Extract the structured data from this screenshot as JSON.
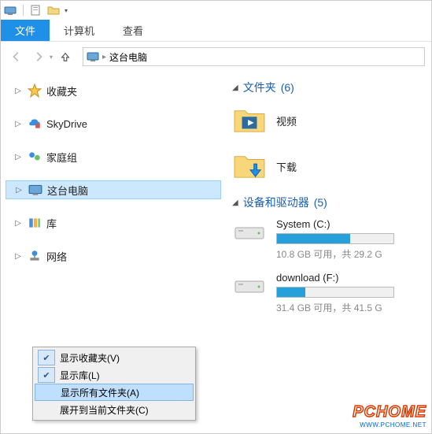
{
  "ribbon": {
    "tabs": [
      "文件",
      "计算机",
      "查看"
    ],
    "active_index": 0
  },
  "address": {
    "location": "这台电脑"
  },
  "sidebar": {
    "items": [
      {
        "label": "收藏夹",
        "icon": "star"
      },
      {
        "label": "SkyDrive",
        "icon": "skydrive"
      },
      {
        "label": "家庭组",
        "icon": "homegroup"
      },
      {
        "label": "这台电脑",
        "icon": "computer",
        "selected": true
      },
      {
        "label": "库",
        "icon": "libraries"
      },
      {
        "label": "网络",
        "icon": "network"
      }
    ]
  },
  "main": {
    "group_folders": {
      "title": "文件夹",
      "count": "(6)"
    },
    "folders": [
      {
        "label": "视频",
        "icon": "videos-folder"
      },
      {
        "label": "下载",
        "icon": "downloads-folder"
      }
    ],
    "group_drives": {
      "title": "设备和驱动器",
      "count": "(5)"
    },
    "drives": [
      {
        "name": "System (C:)",
        "fill_pct": 63,
        "stats": "10.8 GB 可用，共 29.2 G"
      },
      {
        "name": "download (F:)",
        "fill_pct": 24,
        "stats": "31.4 GB 可用，共 41.5 G"
      }
    ]
  },
  "context_menu": {
    "items": [
      {
        "label": "显示收藏夹(V)",
        "checked": true
      },
      {
        "label": "显示库(L)",
        "checked": true
      },
      {
        "label": "显示所有文件夹(A)",
        "checked": false,
        "hover": true
      },
      {
        "label": "展开到当前文件夹(C)",
        "checked": false
      }
    ]
  },
  "watermark": {
    "logo": "PCHOME",
    "url": "WWW.PCHOME.NET"
  }
}
